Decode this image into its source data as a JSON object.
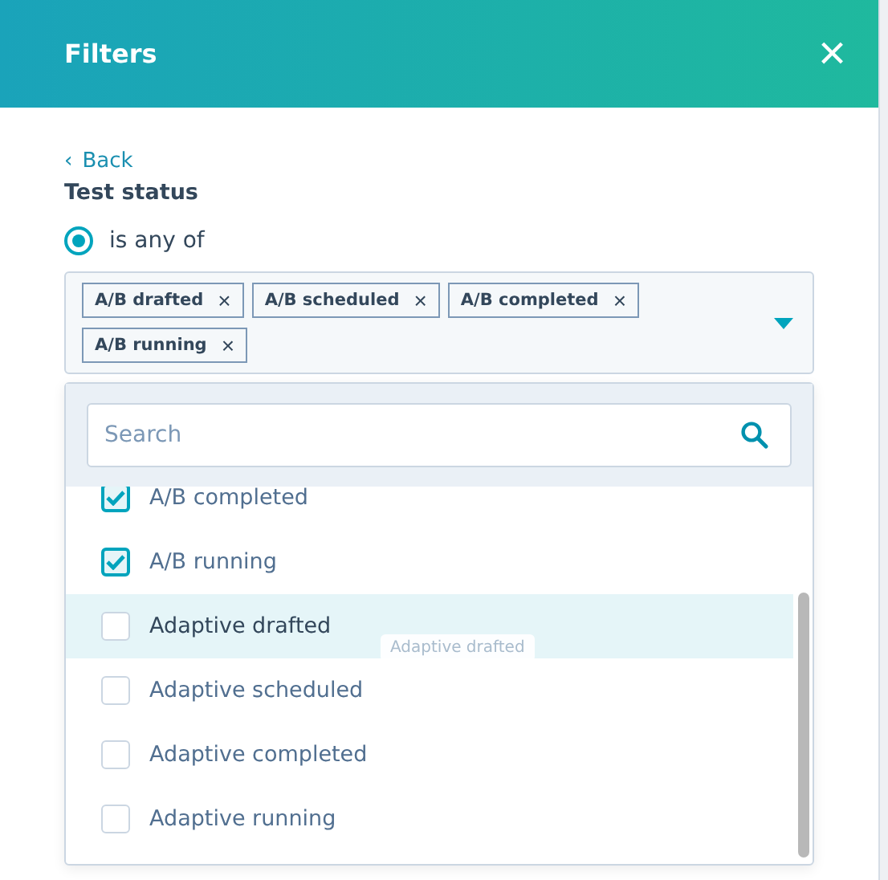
{
  "header": {
    "title": "Filters",
    "close": "×"
  },
  "back": {
    "icon": "‹",
    "label": "Back"
  },
  "field_label": "Test status",
  "operator": {
    "label": "is any of",
    "selected": true
  },
  "tags": [
    {
      "label": "A/B drafted",
      "remove": "×"
    },
    {
      "label": "A/B scheduled",
      "remove": "×"
    },
    {
      "label": "A/B completed",
      "remove": "×"
    },
    {
      "label": "A/B running",
      "remove": "×"
    }
  ],
  "dropdown": {
    "search": {
      "placeholder": "Search"
    },
    "options": [
      {
        "label": "A/B completed",
        "checked": true,
        "selected": false
      },
      {
        "label": "A/B running",
        "checked": true,
        "selected": false
      },
      {
        "label": "Adaptive drafted",
        "checked": false,
        "selected": true
      },
      {
        "label": "Adaptive scheduled",
        "checked": false,
        "selected": false
      },
      {
        "label": "Adaptive completed",
        "checked": false,
        "selected": false
      },
      {
        "label": "Adaptive running",
        "checked": false,
        "selected": false
      }
    ],
    "drag_ghost": "Adaptive drafted"
  }
}
